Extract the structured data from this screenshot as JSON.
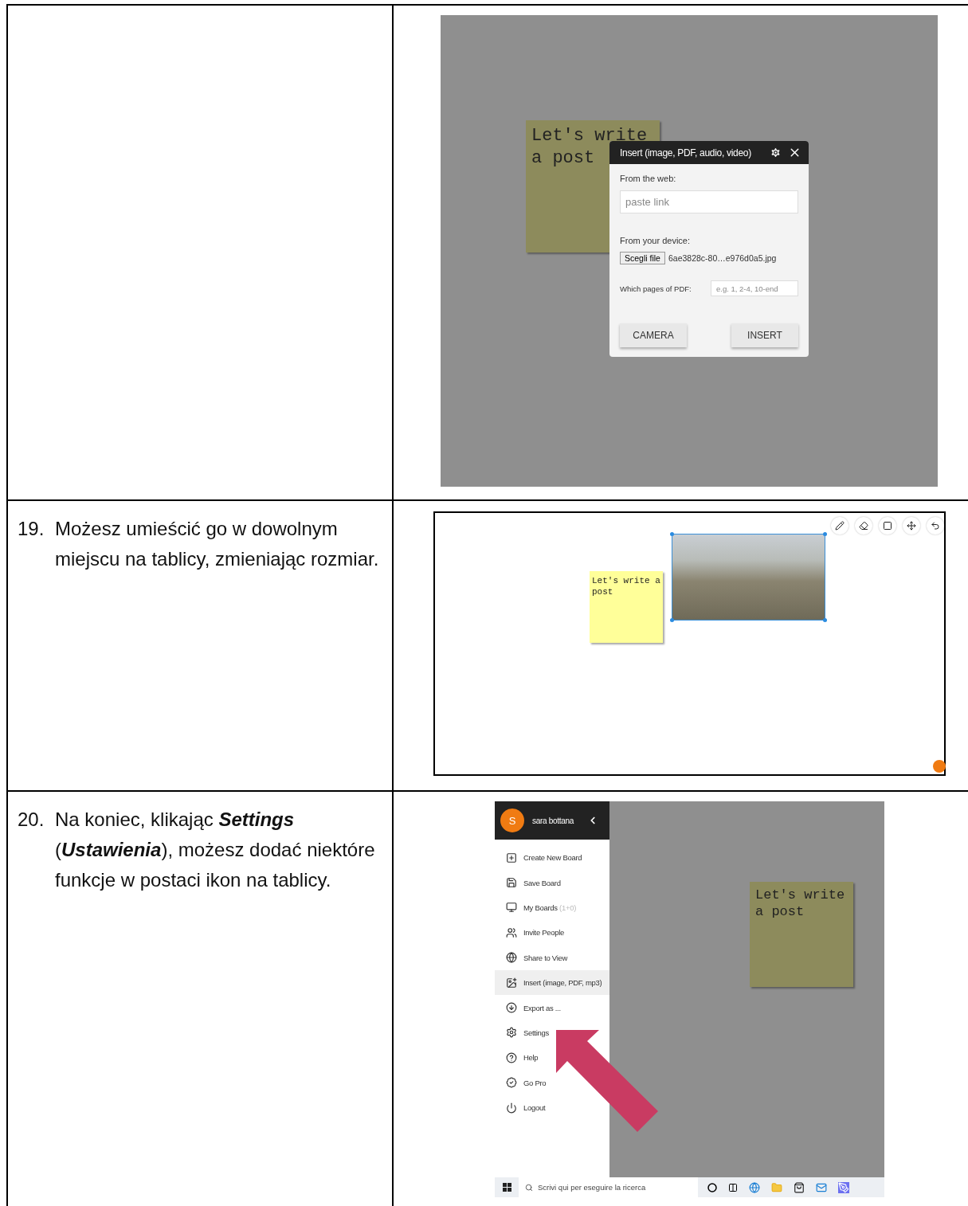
{
  "rows": [
    {
      "kind": "insert-dialog",
      "screenshot": {
        "note_text": "Let's write a post",
        "dialog": {
          "title": "Insert (image, PDF, audio, video)",
          "web_label": "From the web:",
          "link_placeholder": "paste link",
          "device_label": "From your device:",
          "choose_file_button": "Scegli file",
          "file_name": "6ae3828c-80…e976d0a5.jpg",
          "pages_label": "Which pages of PDF:",
          "pages_placeholder": "e.g. 1, 2-4, 10-end",
          "buttons": [
            "CAMERA",
            "INSERT"
          ]
        }
      }
    },
    {
      "kind": "board",
      "number": "19.",
      "text": "Możesz umieścić go w dowolnym miejscu na tablicy, zmieniając rozmiar.",
      "screenshot": {
        "note_text": "Let's write a post",
        "image_selected": true
      }
    },
    {
      "kind": "menu",
      "number": "20.",
      "text": "Na koniec, klikając **Settings** (**Ustawienia**), możesz dodać niektóre funkcje w postaci ikon na tablicy.",
      "screenshot": {
        "user_initial": "S",
        "user_name": "sara bottana",
        "menu_items": [
          {
            "label": "Create New Board",
            "selected": false
          },
          {
            "label": "Save Board",
            "selected": false
          },
          {
            "label": "My Boards",
            "count": "(1+0)",
            "selected": false
          },
          {
            "label": "Invite People",
            "selected": false
          },
          {
            "label": "Share to View",
            "selected": false
          },
          {
            "label": "Insert (image, PDF, mp3)",
            "selected": true
          },
          {
            "label": "Export as ...",
            "selected": false
          },
          {
            "label": "Settings",
            "selected": false
          },
          {
            "label": "Help",
            "selected": false
          },
          {
            "label": "Go Pro",
            "selected": false
          },
          {
            "label": "Logout",
            "selected": false
          }
        ],
        "note_text": "Let's write a post",
        "taskbar_search_placeholder": "Scrivi qui per eseguire la ricerca"
      }
    }
  ]
}
